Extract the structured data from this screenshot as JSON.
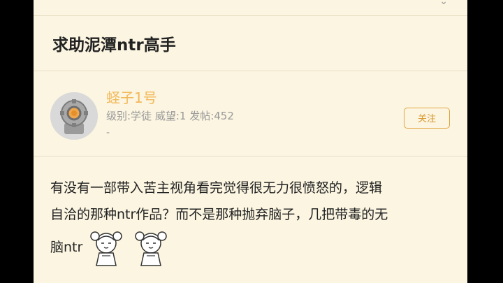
{
  "post": {
    "title": "求助泥潭ntr高手",
    "author": {
      "name": "蛏子1号",
      "meta": "级别:学徒 威望:1 发帖:452",
      "extra": "-",
      "avatar_icon": "diving-helmet-icon"
    },
    "follow_label": "关注",
    "body": {
      "line1": "有没有一部带入苦主视角看完觉得很无力很愤怒的，逻辑",
      "line2": "自洽的那种ntr作品？而不是那种抛弃脑子，几把带毒的无",
      "line3": "脑ntr"
    },
    "stickers": [
      "anime-girl-sticker-icon",
      "anime-girl-sticker-icon"
    ]
  },
  "colors": {
    "background": "#fbf5e1",
    "username": "#f2b95a",
    "accent": "#e2a543",
    "text": "#222222",
    "meta": "#999999"
  }
}
